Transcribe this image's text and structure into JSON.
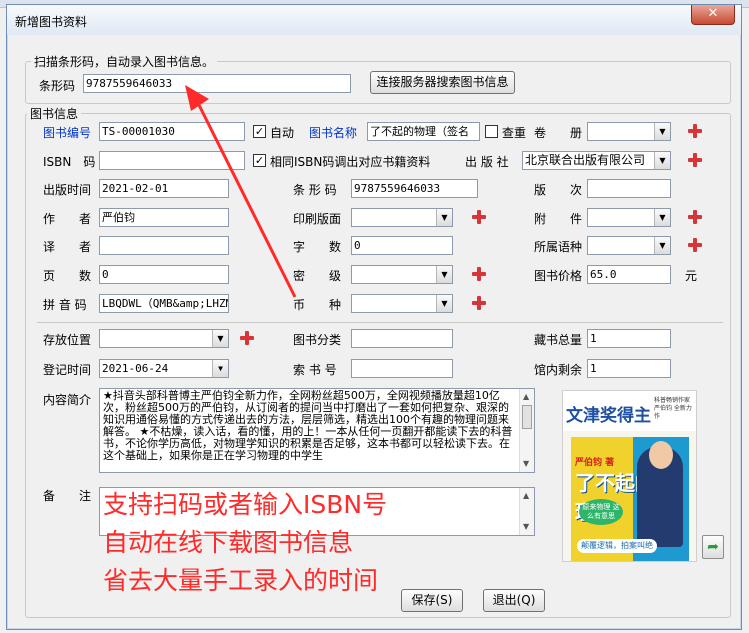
{
  "window": {
    "title": "新增图书资料",
    "close_label": "✕"
  },
  "scan_group": {
    "title": "扫描条形码，自动录入图书信息。",
    "barcode_label": "条形码",
    "barcode_value": "9787559646033",
    "search_button": "连接服务器搜索图书信息"
  },
  "info_group": {
    "title": "图书信息"
  },
  "fields": {
    "book_no_label": "图书编号",
    "book_no": "TS-00001030",
    "auto_label": "自动",
    "book_name_label": "图书名称",
    "book_name": "了不起的物理（签名",
    "dup_label": "查重",
    "volume_label": "卷　　册",
    "isbn_label": "ISBN　码",
    "isbn_fetch_label": "相同ISBN码调出对应书籍资料",
    "publisher_label": "出 版 社",
    "publisher": "北京联合出版有限公司",
    "pub_date_label": "出版时间",
    "pub_date": "2021-02-01",
    "barcode_label": "条 形 码",
    "barcode": "9787559646033",
    "edition_label": "版　　次",
    "author_label": "作　　者",
    "author": "严伯钧",
    "print_layout_label": "印刷版面",
    "attach_label": "附　　件",
    "translator_label": "译　　者",
    "word_count_label": "字　　数",
    "word_count": "0",
    "language_label": "所属语种",
    "pages_label": "页　　数",
    "pages": "0",
    "secret_label": "密　　级",
    "price_label": "图书价格",
    "price": "65.0",
    "price_unit": "元",
    "pinyin_label": "拼 音 码",
    "pinyin": "LBQDWL（QMB&amp;LHZMB",
    "currency_label": "币　　种",
    "location_label": "存放位置",
    "category_label": "图书分类",
    "total_label": "藏书总量",
    "total": "1",
    "reg_date_label": "登记时间",
    "reg_date": "2021-06-24",
    "call_no_label": "索 书 号",
    "remaining_label": "馆内剩余",
    "remaining": "1",
    "summary_label": "内容简介",
    "summary": "★抖音头部科普博主严伯钧全新力作，全网粉丝超500万，全网视频播放量超10亿次，粉丝超500万的严伯钧，从订阅者的提问当中打磨出了一套如何把复杂、艰深的知识用通俗易懂的方式传递出去的方法，层层筛选，精选出100个有趣的物理问题来解答。 ★不枯燥，读入话，看的懂，用的上！一本从任何一页翻开都能读下去的科普书，不论你学历高低，对物理学知识的积累是否足够，这本书都可以轻松读下去。在这个基础上，如果你是正在学习物理的中学生",
    "remark_label": "备　　注"
  },
  "overlay_text": [
    "支持扫码或者输入ISBN号",
    "自动在线下载图书信息",
    "省去大量手工录入的时间"
  ],
  "cover": {
    "badge": "文津奖得主",
    "sub": "科普畅销作家 严伯钧 全新力作",
    "book_small": "严伯钧 著",
    "book_title": "了不起的物理",
    "plate": "原来物理 这么有意思",
    "bar": "颠覆逻辑，拍案叫绝"
  },
  "buttons": {
    "save": "保存(S)",
    "exit": "退出(Q)"
  },
  "colors": {
    "label_blue": "#0033cc",
    "overlay_red": "#ff2a2a",
    "plus_red": "#d8353a"
  }
}
